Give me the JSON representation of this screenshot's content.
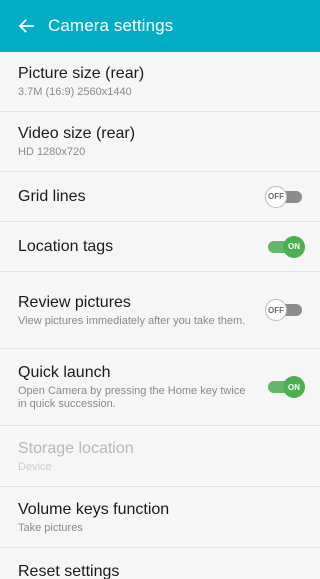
{
  "app_bar": {
    "title": "Camera settings",
    "back_icon": "back-arrow-icon",
    "color": "#02aec6"
  },
  "settings": [
    {
      "id": "picture-size-rear",
      "title": "Picture size (rear)",
      "subtitle": "3.7M (16:9) 2560x1440"
    },
    {
      "id": "video-size-rear",
      "title": "Video size (rear)",
      "subtitle": "HD 1280x720"
    },
    {
      "id": "grid-lines",
      "title": "Grid lines",
      "toggle": "OFF"
    },
    {
      "id": "location-tags",
      "title": "Location tags",
      "toggle": "ON"
    },
    {
      "id": "review-pictures",
      "title": "Review pictures",
      "subtitle": "View pictures immediately after you take them.",
      "toggle": "OFF"
    },
    {
      "id": "quick-launch",
      "title": "Quick launch",
      "subtitle": "Open Camera by pressing the Home key twice in quick succession.",
      "toggle": "ON"
    },
    {
      "id": "storage-location",
      "title": "Storage location",
      "subtitle": "Device",
      "disabled": true
    },
    {
      "id": "volume-keys-function",
      "title": "Volume keys function",
      "subtitle": "Take pictures"
    },
    {
      "id": "reset-settings",
      "title": "Reset settings"
    }
  ],
  "colors": {
    "toggle_on": "#4caf50",
    "toggle_off": "#8c8c8c",
    "disabled_text": "#b8b8b8"
  }
}
